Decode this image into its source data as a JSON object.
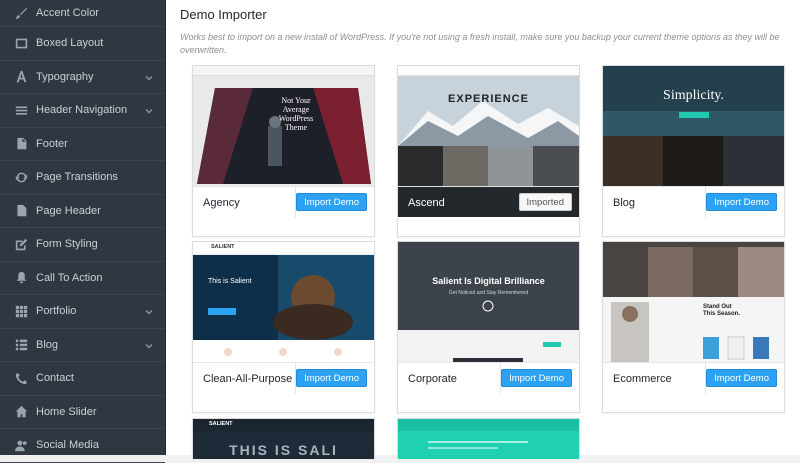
{
  "sidebar": {
    "items": [
      {
        "label": "Accent Color",
        "icon": "brush-icon",
        "expandable": false
      },
      {
        "label": "Boxed Layout",
        "icon": "boxed-layout-icon",
        "expandable": false
      },
      {
        "label": "Typography",
        "icon": "typography-icon",
        "expandable": true
      },
      {
        "label": "Header Navigation",
        "icon": "menu-icon",
        "expandable": true
      },
      {
        "label": "Footer",
        "icon": "file-icon",
        "expandable": false
      },
      {
        "label": "Page Transitions",
        "icon": "refresh-icon",
        "expandable": false
      },
      {
        "label": "Page Header",
        "icon": "file-icon",
        "expandable": false
      },
      {
        "label": "Form Styling",
        "icon": "edit-icon",
        "expandable": false
      },
      {
        "label": "Call To Action",
        "icon": "bell-icon",
        "expandable": false
      },
      {
        "label": "Portfolio",
        "icon": "grid-icon",
        "expandable": true
      },
      {
        "label": "Blog",
        "icon": "list-icon",
        "expandable": true
      },
      {
        "label": "Contact",
        "icon": "phone-icon",
        "expandable": false
      },
      {
        "label": "Home Slider",
        "icon": "home-icon",
        "expandable": false
      },
      {
        "label": "Social Media",
        "icon": "users-icon",
        "expandable": false
      }
    ]
  },
  "main": {
    "title": "Demo Importer",
    "description": "Works best to import on a new install of WordPress. If you're not using a fresh install, make sure you backup your current theme options as they will be overwritten.",
    "demos": [
      {
        "name": "Agency",
        "button": "Import Demo",
        "imported": false,
        "thumb_text": [
          "Not Your",
          "Average",
          "WordPress",
          "Theme"
        ]
      },
      {
        "name": "Ascend",
        "button": "Imported",
        "imported": true,
        "thumb_text": [
          "EXPERIENCE"
        ]
      },
      {
        "name": "Blog",
        "button": "Import Demo",
        "imported": false,
        "thumb_text": [
          "Simplicity."
        ]
      },
      {
        "name": "Clean-All-Purpose",
        "button": "Import Demo",
        "imported": false,
        "thumb_text": [
          "SALIENT",
          "This is Salient"
        ]
      },
      {
        "name": "Corporate",
        "button": "Import Demo",
        "imported": false,
        "thumb_text": [
          "Salient Is Digital Brilliance",
          "Get Noticed and Stay Remembered"
        ]
      },
      {
        "name": "Ecommerce",
        "button": "Import Demo",
        "imported": false,
        "thumb_text": [
          "Stand Out",
          "This Season."
        ]
      },
      {
        "name": "",
        "button": "",
        "imported": false,
        "thumb_text": [
          "SALIENT",
          "THIS IS SALI"
        ]
      },
      {
        "name": "",
        "button": "",
        "imported": false,
        "thumb_text": []
      }
    ]
  },
  "colors": {
    "sidebar_bg": "#2f3841",
    "accent": "#2ea2f2",
    "teal": "#1ec9b0"
  }
}
